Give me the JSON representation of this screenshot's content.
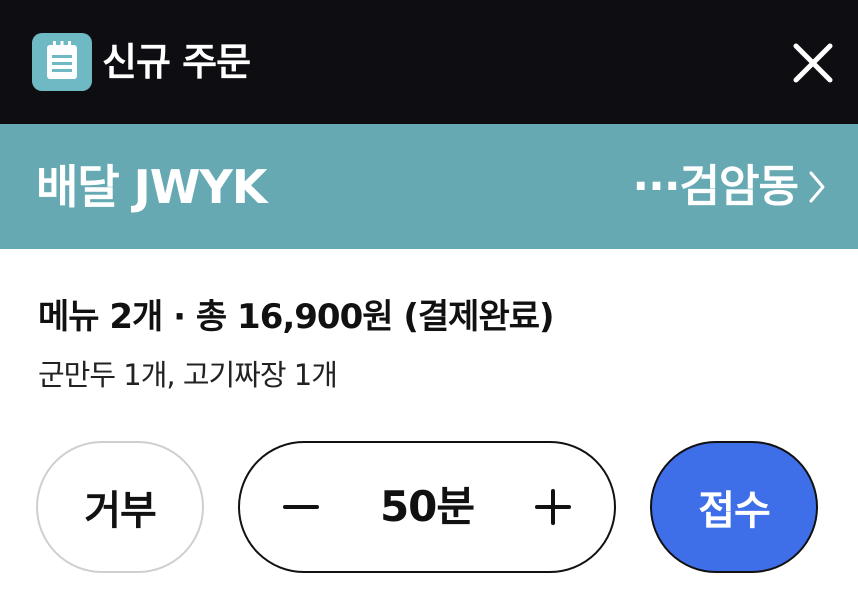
{
  "window": {
    "title": "신규 주문",
    "icon": "order-notepad-icon",
    "close_icon": "close-icon"
  },
  "delivery": {
    "label": "배달 JWYK",
    "location": "···검암동",
    "location_icon": "chevron-right-icon"
  },
  "order": {
    "summary": "메뉴 2개 · 총 16,900원 (결제완료)",
    "items": "군만두 1개, 고기짜장 1개"
  },
  "actions": {
    "reject_label": "거부",
    "time_value": "50분",
    "accept_label": "접수"
  },
  "colors": {
    "titlebar": "#0d0d12",
    "delivery_bar": "#66a9b3",
    "accept_button": "#3e6ee8"
  }
}
